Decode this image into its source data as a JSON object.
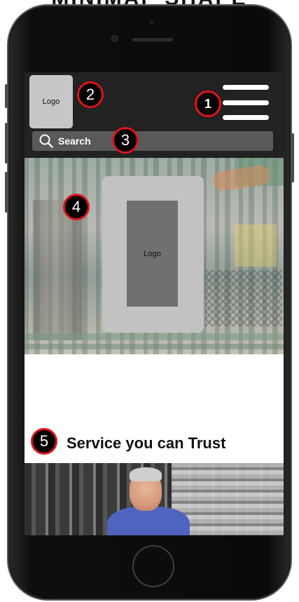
{
  "caption": {
    "text": "MINIMAP SHAPE"
  },
  "header": {
    "logo_label": "Logo",
    "search_label": "Search",
    "menu_icon": "hamburger-menu-icon",
    "search_icon": "search-icon"
  },
  "hero": {
    "logo_label": "Logo"
  },
  "tagline": {
    "text": "Service you can Trust"
  },
  "callouts": [
    "1",
    "2",
    "3",
    "4",
    "5"
  ],
  "colors": {
    "header_bg": "#222222",
    "search_bg": "#5a5a5a",
    "logo_placeholder": "#c7c7c7",
    "hero_logo_outer": "#c2c2c2",
    "hero_logo_inner": "#707070",
    "callout_ring": "#e0141c",
    "callout_fill": "#000000"
  }
}
